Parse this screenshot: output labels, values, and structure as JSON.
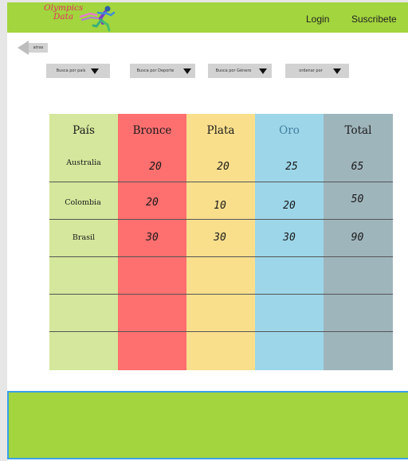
{
  "header": {
    "logo_line1": "Olympics",
    "logo_line2": "Data",
    "login_label": "Login",
    "subscribe_label": "Suscribete"
  },
  "back": {
    "label": "atras"
  },
  "filters": [
    {
      "label": "Busca por país"
    },
    {
      "label": "Busca por Deporte"
    },
    {
      "label": "Busca por Género"
    },
    {
      "label": "ordenar por"
    }
  ],
  "table": {
    "headers": [
      "País",
      "Bronce",
      "Plata",
      "Oro",
      "Total"
    ],
    "column_colors": [
      "#d4e79c",
      "#fe6f6f",
      "#f9df8c",
      "#9dd6e9",
      "#9fb5bc"
    ],
    "header_text_colors": [
      "#1a1a1a",
      "#1a1a1a",
      "#1a1a1a",
      "#3f7fa0",
      "#1a1a1a"
    ],
    "rows": [
      {
        "pais": "Australia",
        "bronce": "20",
        "plata": "20",
        "oro": "25",
        "total": "65"
      },
      {
        "pais": "Colombia",
        "bronce": "20",
        "plata": "10",
        "oro": "20",
        "total": "50"
      },
      {
        "pais": "Brasil",
        "bronce": "30",
        "plata": "30",
        "oro": "30",
        "total": "90"
      }
    ]
  },
  "colors": {
    "header_bg": "#a3d53e",
    "footer_bg": "#a3d53e",
    "footer_border": "#3aa0e8",
    "logo_text": "#e3305c"
  },
  "icons": [
    "runner-icon",
    "back-arrow-icon",
    "dropdown-caret-icon"
  ]
}
